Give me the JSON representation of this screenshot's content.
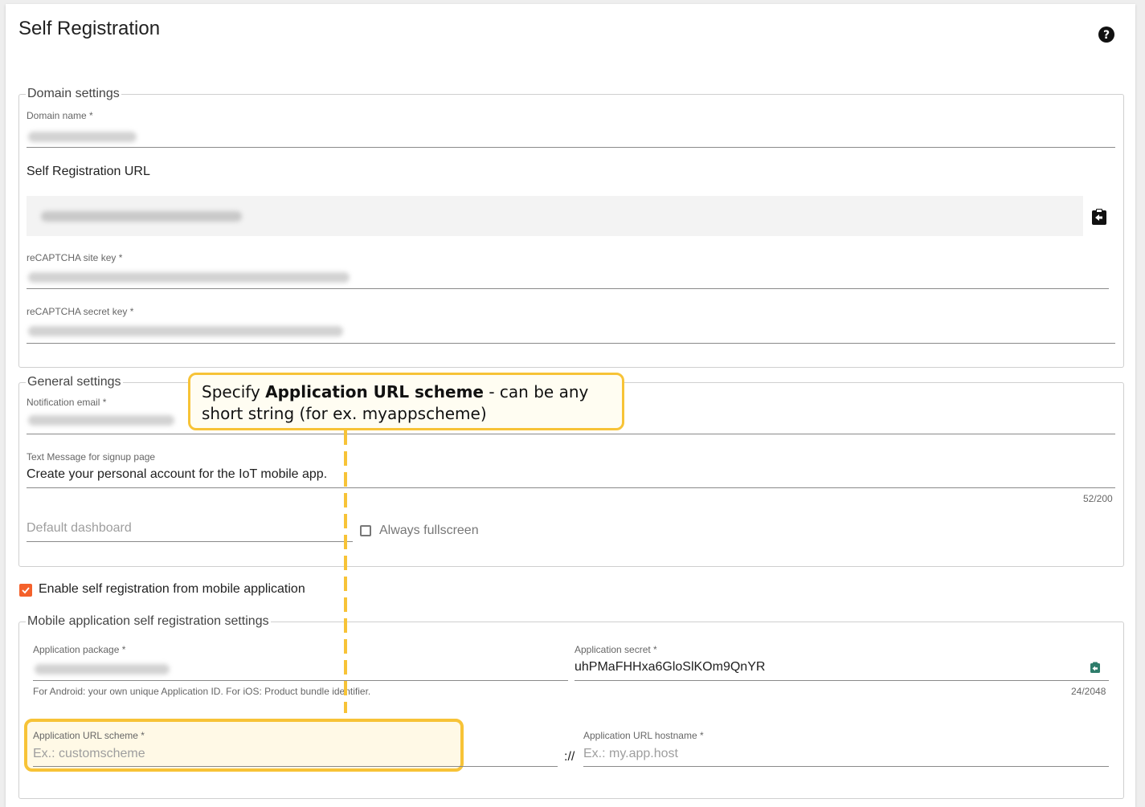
{
  "page": {
    "title": "Self Registration"
  },
  "domain_settings": {
    "legend": "Domain settings",
    "domain_name_label": "Domain name *",
    "self_registration_url_label": "Self Registration URL",
    "recaptcha_site_key_label": "reCAPTCHA site key *",
    "recaptcha_secret_key_label": "reCAPTCHA secret key *"
  },
  "general_settings": {
    "legend": "General settings",
    "notification_email_label": "Notification email *",
    "text_message_label": "Text Message for signup page",
    "text_message_value": "Create your personal account for the IoT mobile app.",
    "text_message_counter": "52/200",
    "default_dashboard_placeholder": "Default dashboard",
    "always_fullscreen_label": "Always fullscreen",
    "always_fullscreen_checked": false
  },
  "mobile": {
    "enable_label": "Enable self registration from mobile application",
    "enable_checked": true,
    "legend": "Mobile application self registration settings",
    "app_package_label": "Application package *",
    "app_package_hint": "For Android: your own unique Application ID. For iOS: Product bundle identifier.",
    "app_secret_label": "Application secret *",
    "app_secret_value": "uhPMaFHHxa6GloSlKOm9QnYR",
    "app_secret_counter": "24/2048",
    "url_scheme_label": "Application URL scheme *",
    "url_scheme_placeholder": "Ex.: customscheme",
    "separator": "://",
    "url_hostname_label": "Application URL hostname *",
    "url_hostname_placeholder": "Ex.: my.app.host"
  },
  "callout": {
    "prefix": "Specify ",
    "bold": "Application URL scheme",
    "suffix": " - can be any short string (for ex. myappscheme)"
  },
  "colors": {
    "accent": "#f4612b",
    "highlight": "#f7c337",
    "copy_icon": "#2e7d6b"
  }
}
